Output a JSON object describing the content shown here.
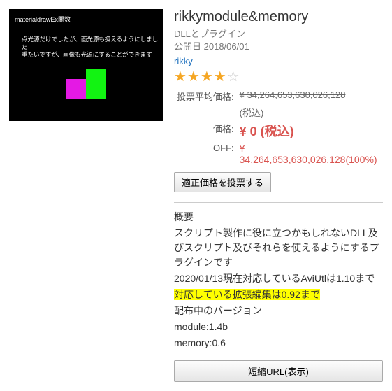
{
  "thumb": {
    "caption": "materialdrawEx関数",
    "line1": "点光源だけでしたが、面光源も扱えるようにしました",
    "line2": "重たいですが、画像も光源にすることができます"
  },
  "title": "rikkymodule&memory",
  "category": "DLLとプラグイン",
  "date_label": "公開日",
  "date": "2018/06/01",
  "author": "rikky",
  "stars_full": "★★★★",
  "stars_empty": "☆",
  "price": {
    "avg_label": "投票平均価格:",
    "avg_value": "¥ 34,264,653,630,026,128",
    "tax_memo": "(税込)",
    "price_label": "価格:",
    "price_value": "¥ 0 (税込)",
    "off_label": "OFF:",
    "off_value": "¥ 34,264,653,630,026,128(100%)"
  },
  "vote_btn": "適正価格を投票する",
  "desc": {
    "heading": "概要",
    "l1": "スクリプト製作に役に立つかもしれないDLL及びスクリプト及びそれらを使えるようにするプラグインです",
    "l2": "2020/01/13現在対応しているAviUtlは1.10まで",
    "l3": "対応している拡張編集は0.92まで",
    "l4": "配布中のバージョン",
    "l5": "module:1.4b",
    "l6": "memory:0.6"
  },
  "short_url_btn": "短縮URL(表示)"
}
